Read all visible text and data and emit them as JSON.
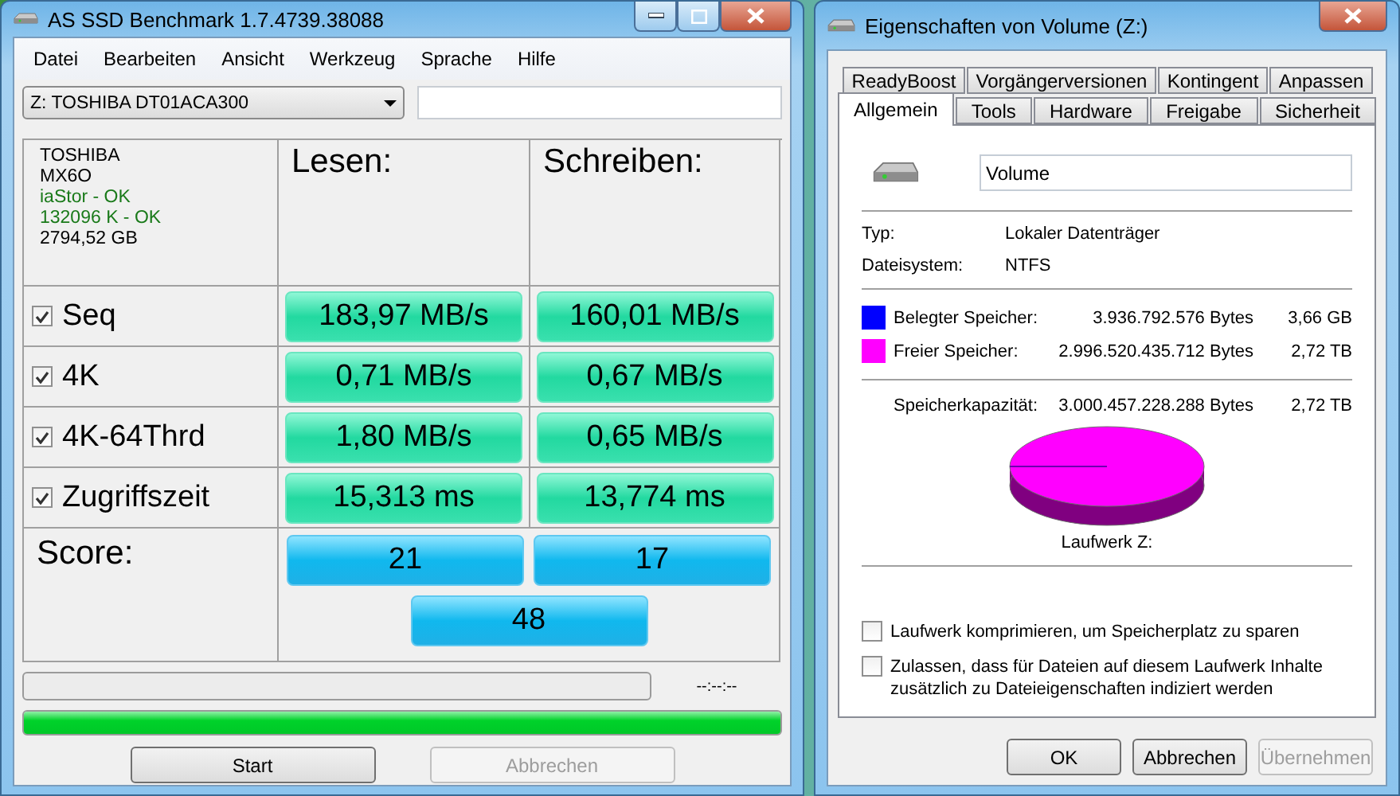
{
  "benchmark": {
    "title": "AS SSD Benchmark 1.7.4739.38088",
    "menu": [
      "Datei",
      "Bearbeiten",
      "Ansicht",
      "Werkzeug",
      "Sprache",
      "Hilfe"
    ],
    "drive": "Z: TOSHIBA DT01ACA300",
    "info": [
      {
        "text": "TOSHIBA",
        "kind": "normal"
      },
      {
        "text": "MX6O",
        "kind": "normal"
      },
      {
        "text": "iaStor - OK",
        "kind": "ok"
      },
      {
        "text": "132096 K - OK",
        "kind": "ok"
      },
      {
        "text": "2794,52 GB",
        "kind": "normal"
      }
    ],
    "columns": [
      "Lesen:",
      "Schreiben:"
    ],
    "tests": [
      {
        "name": "Seq",
        "checked": true,
        "read": "183,97 MB/s",
        "write": "160,01 MB/s"
      },
      {
        "name": "4K",
        "checked": true,
        "read": "0,71 MB/s",
        "write": "0,67 MB/s"
      },
      {
        "name": "4K-64Thrd",
        "checked": true,
        "read": "1,80 MB/s",
        "write": "0,65 MB/s"
      },
      {
        "name": "Zugriffszeit",
        "checked": true,
        "read": "15,313 ms",
        "write": "13,774 ms"
      }
    ],
    "score": {
      "label": "Score:",
      "read": "21",
      "write": "17",
      "total": "48"
    },
    "progress": {
      "level": 0,
      "time": "--:--:--"
    },
    "total_progress": {
      "level": 1
    },
    "buttons": [
      {
        "label": "Start",
        "disabled": false
      },
      {
        "label": "Abbrechen",
        "disabled": true
      }
    ]
  },
  "properties": {
    "title": "Eigenschaften von Volume (Z:)",
    "tab_rows": [
      [
        {
          "label": "ReadyBoost",
          "selected": false
        },
        {
          "label": "Vorgängerversionen",
          "selected": false
        },
        {
          "label": "Kontingent",
          "selected": false
        },
        {
          "label": "Anpassen",
          "selected": false
        }
      ],
      [
        {
          "label": "Allgemein",
          "selected": true
        },
        {
          "label": "Tools",
          "selected": false
        },
        {
          "label": "Hardware",
          "selected": false
        },
        {
          "label": "Freigabe",
          "selected": false
        },
        {
          "label": "Sicherheit",
          "selected": false
        }
      ]
    ],
    "name": "Volume",
    "details": [
      {
        "label": "Typ:",
        "value": "Lokaler Datenträger"
      },
      {
        "label": "Dateisystem:",
        "value": "NTFS"
      }
    ],
    "space": [
      {
        "label": "Belegter Speicher:",
        "bytes": "3.936.792.576 Bytes",
        "size": "3,66 GB",
        "color": "#0000ff"
      },
      {
        "label": "Freier Speicher:",
        "bytes": "2.996.520.435.712 Bytes",
        "size": "2,72 TB",
        "color": "#ff00ff"
      }
    ],
    "capacity": {
      "label": "Speicherkapazität:",
      "bytes": "3.000.457.228.288 Bytes",
      "size": "2,72 TB"
    },
    "drive_label": "Laufwerk Z:",
    "options": [
      {
        "label": "Laufwerk komprimieren, um Speicherplatz zu sparen",
        "checked": false
      },
      {
        "label": "Zulassen, dass für Dateien auf diesem Laufwerk Inhalte zusätzlich zu Dateieigenschaften indiziert werden",
        "checked": false
      }
    ],
    "buttons": [
      {
        "label": "OK",
        "disabled": false
      },
      {
        "label": "Abbrechen",
        "disabled": false
      },
      {
        "label": "Übernehmen",
        "disabled": true
      }
    ]
  }
}
